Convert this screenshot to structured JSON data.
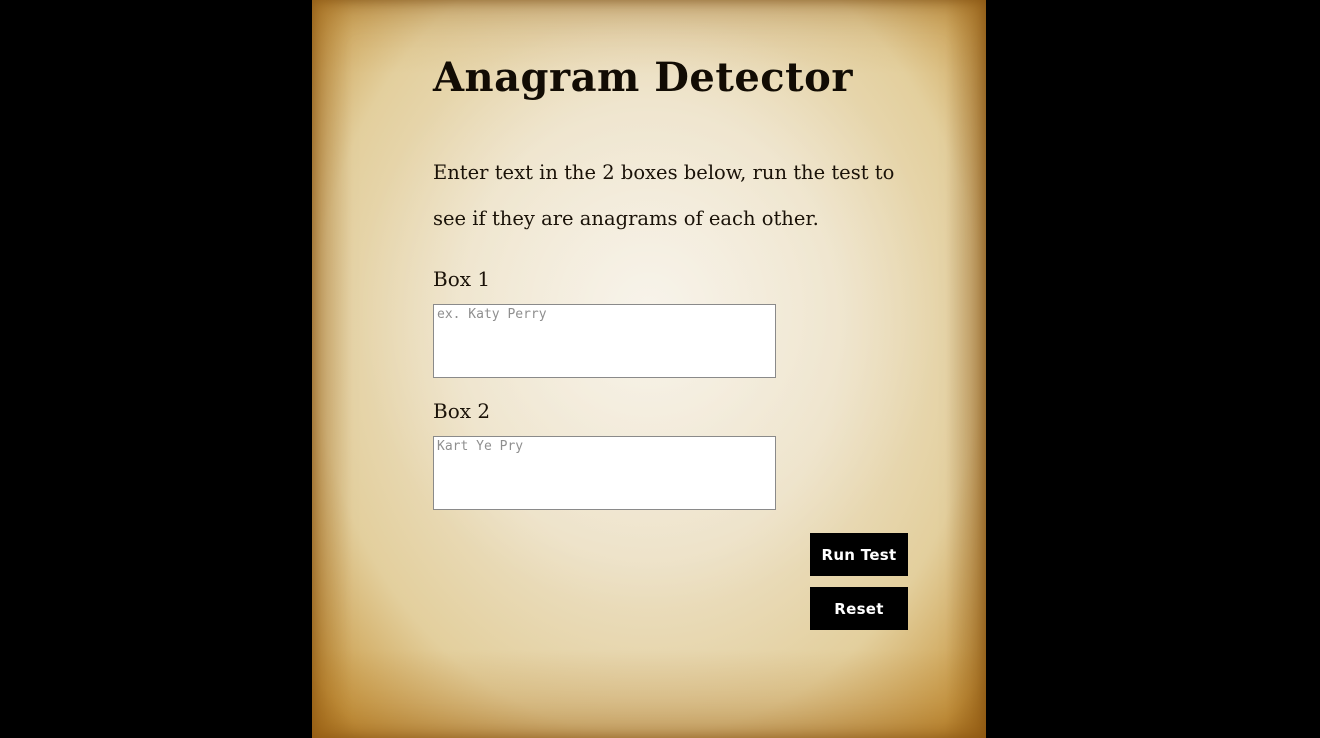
{
  "page": {
    "title": "Anagram Detector",
    "intro": "Enter text in the 2 boxes below, run the test to see if they are anagrams of each other."
  },
  "form": {
    "box1": {
      "label": "Box 1",
      "value": "",
      "placeholder": "ex. Katy Perry"
    },
    "box2": {
      "label": "Box 2",
      "value": "",
      "placeholder": "Kart Ye Pry"
    },
    "run_label": "Run Test",
    "reset_label": "Reset"
  },
  "colors": {
    "background": "#000000",
    "parchment": "#ece0c4",
    "button": "#000000",
    "button_text": "#ffffff"
  }
}
